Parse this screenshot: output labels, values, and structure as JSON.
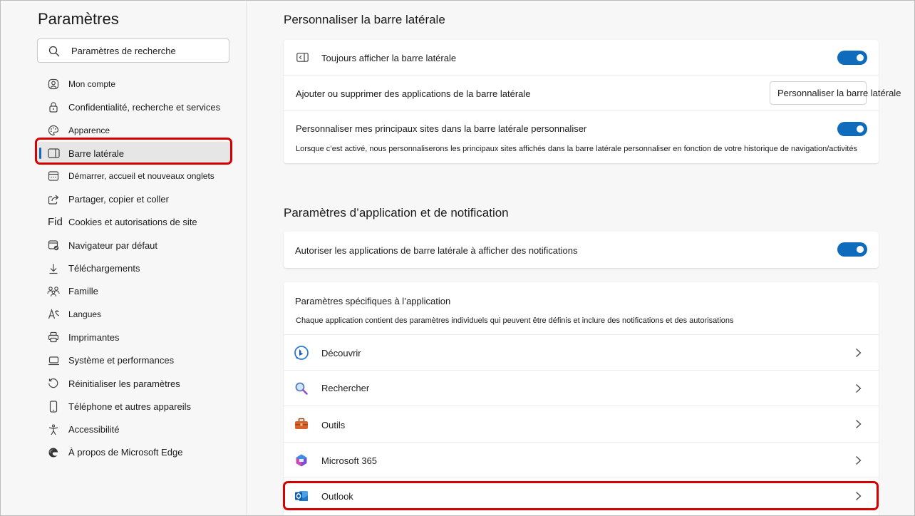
{
  "sidebar": {
    "title": "Paramètres",
    "search_placeholder": "Paramètres de recherche",
    "items": [
      {
        "label": "Mon compte",
        "icon": "account-icon"
      },
      {
        "label": "Confidentialité, recherche et services",
        "icon": "lock-icon"
      },
      {
        "label": "Apparence",
        "icon": "palette-icon"
      },
      {
        "label": "Barre latérale",
        "icon": "sidebar-icon",
        "active": true
      },
      {
        "label": "Démarrer, accueil et nouveaux onglets",
        "icon": "home-tabs-icon"
      },
      {
        "label": "Partager, copier et coller",
        "icon": "share-icon"
      },
      {
        "label": "Cookies et autorisations de site",
        "icon": "cookie-icon",
        "icon_text": "Fid"
      },
      {
        "label": "Navigateur par défaut",
        "icon": "browser-icon"
      },
      {
        "label": "Téléchargements",
        "icon": "download-icon"
      },
      {
        "label": "Famille",
        "icon": "family-icon"
      },
      {
        "label": "Langues",
        "icon": "language-icon"
      },
      {
        "label": "Imprimantes",
        "icon": "printer-icon"
      },
      {
        "label": "Système et performances",
        "icon": "laptop-icon"
      },
      {
        "label": "Réinitialiser les paramètres",
        "icon": "reset-icon"
      },
      {
        "label": "Téléphone et autres appareils",
        "icon": "phone-icon"
      },
      {
        "label": "Accessibilité",
        "icon": "accessibility-icon"
      },
      {
        "label": "À propos de Microsoft Edge",
        "icon": "edge-icon"
      }
    ]
  },
  "main": {
    "section1": {
      "title": "Personnaliser la barre latérale",
      "always_show_label": "Toujours afficher la barre latérale",
      "always_show_on": true,
      "add_remove_label": "Ajouter ou supprimer des applications de la barre latérale",
      "customize_button": "Personnaliser la barre latérale",
      "personalize_label": "Personnaliser mes principaux sites dans la barre latérale personnaliser",
      "personalize_on": true,
      "personalize_desc": "Lorsque c’est activé, nous personnaliserons les principaux sites affichés dans la barre latérale personnaliser en fonction de votre historique de navigation/activités"
    },
    "section2": {
      "title": "Paramètres d’application et de notification",
      "allow_notif_label": "Autoriser les applications de barre latérale à afficher des notifications",
      "allow_notif_on": true,
      "app_specific_title": "Paramètres spécifiques à l’application",
      "app_specific_desc": "Chaque application contient des paramètres individuels qui peuvent être définis et inclure des notifications et des autorisations",
      "apps": [
        {
          "label": "Découvrir",
          "icon": "bing-discover-icon"
        },
        {
          "label": "Rechercher",
          "icon": "search-magnifier-icon"
        },
        {
          "label": "Outils",
          "icon": "toolbox-icon"
        },
        {
          "label": "Microsoft 365",
          "icon": "microsoft365-icon"
        },
        {
          "label": "Outlook",
          "icon": "outlook-icon"
        }
      ]
    }
  },
  "colors": {
    "accent": "#0f6cbd",
    "highlight": "#d50000"
  }
}
